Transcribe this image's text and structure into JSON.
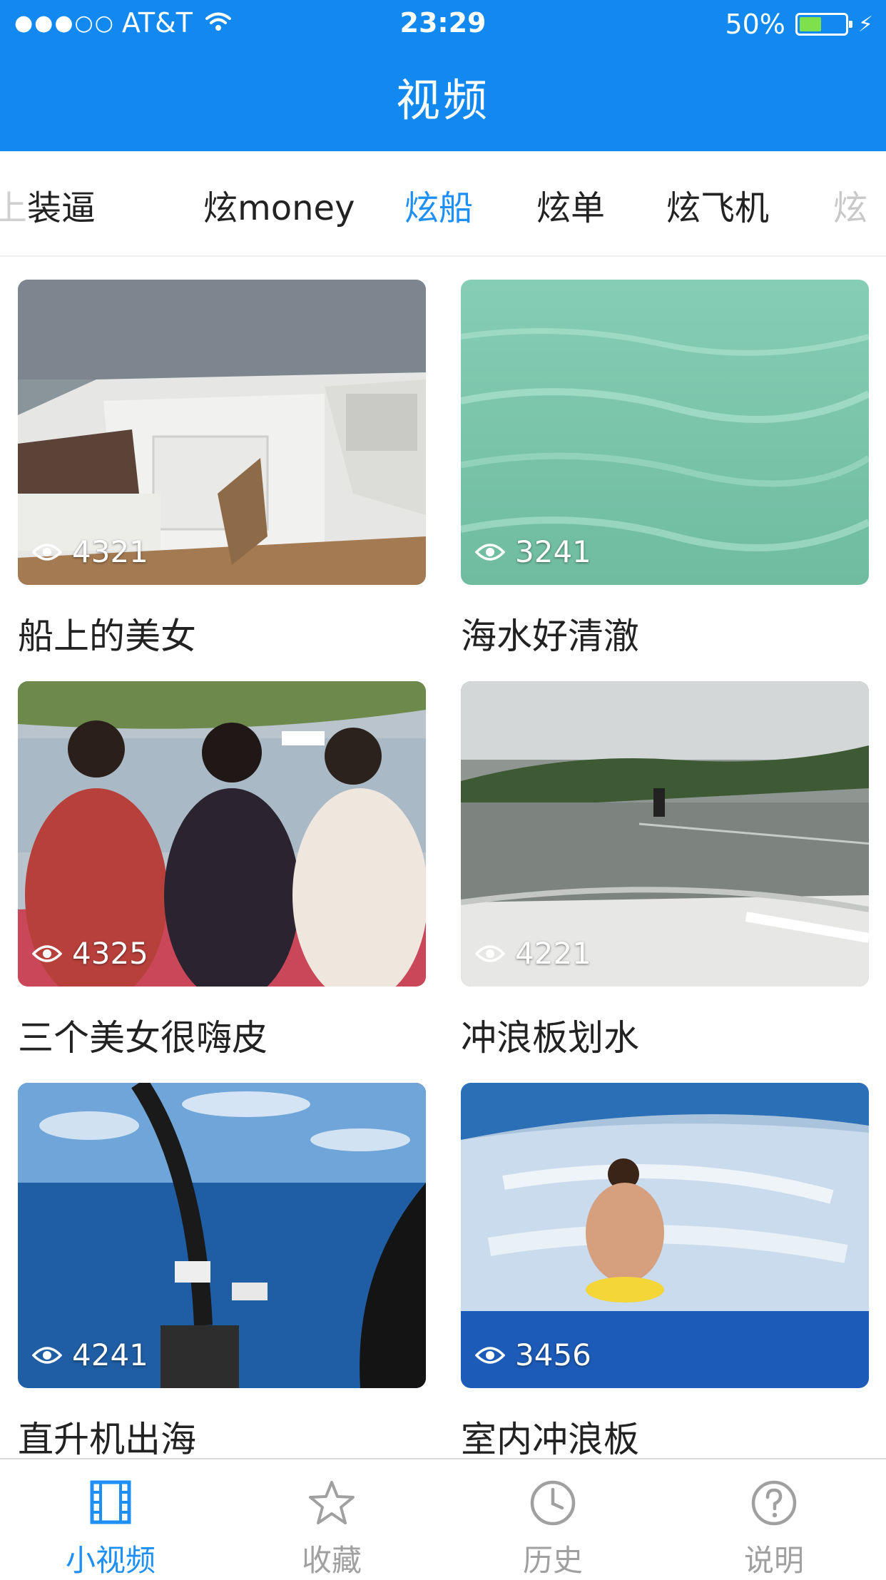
{
  "status_bar": {
    "carrier": "AT&T",
    "signal": "●●●○○",
    "time": "23:29",
    "battery": "50%"
  },
  "nav": {
    "title": "视频"
  },
  "categories": [
    "上装逼",
    "炫money",
    "炫船",
    "炫单",
    "炫飞机",
    "炫"
  ],
  "active_category": "炫船",
  "videos": [
    {
      "views": "4321",
      "title": "船上的美女"
    },
    {
      "views": "3241",
      "title": "海水好清澈"
    },
    {
      "views": "4325",
      "title": "三个美女很嗨皮"
    },
    {
      "views": "4221",
      "title": "冲浪板划水"
    },
    {
      "views": "4241",
      "title": "直升机出海"
    },
    {
      "views": "3456",
      "title": "室内冲浪板"
    }
  ],
  "tabbar": [
    {
      "label": "小视频",
      "icon": "film-icon",
      "active": true
    },
    {
      "label": "收藏",
      "icon": "star-icon",
      "active": false
    },
    {
      "label": "历史",
      "icon": "clock-icon",
      "active": false
    },
    {
      "label": "说明",
      "icon": "help-icon",
      "active": false
    }
  ],
  "colors": {
    "brand": "#1289f0",
    "accent": "#1e90f5",
    "inactive": "#a0a0a0"
  }
}
